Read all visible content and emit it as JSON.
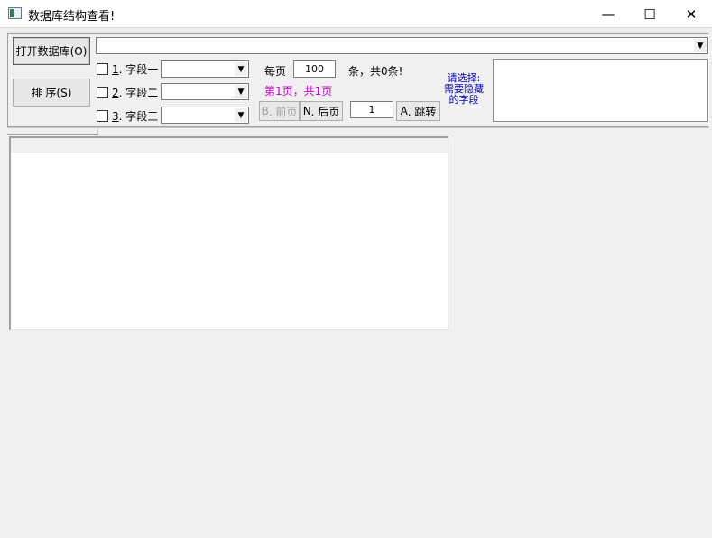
{
  "window": {
    "title": "数据库结构查看!",
    "minimize": "—",
    "maximize": "☐",
    "close": "✕"
  },
  "toolbar": {
    "open_db_label": "打开数据库(O)",
    "sort_label": "排 序(S)",
    "db_path_value": "",
    "fields": [
      {
        "num": "1",
        "label": ". 字段一",
        "value": ""
      },
      {
        "num": "2",
        "label": ". 字段二",
        "value": ""
      },
      {
        "num": "3",
        "label": ". 字段三",
        "value": ""
      }
    ],
    "per_page_label": "每页",
    "per_page_value": "100",
    "total_label": "条，共0条!",
    "page_status": "第1页，共1页",
    "prev_key": "B",
    "prev_label": ". 前页",
    "next_key": "N",
    "next_label": ". 后页",
    "jump_value": "1",
    "jump_key": "A",
    "jump_label": ". 跳转",
    "hide_prompt_line1": "请选择:",
    "hide_prompt_line2": "需要隐藏",
    "hide_prompt_line3": "的字段"
  },
  "colors": {
    "page_status": "#cc00cc",
    "hide_prompt": "#0000aa"
  }
}
